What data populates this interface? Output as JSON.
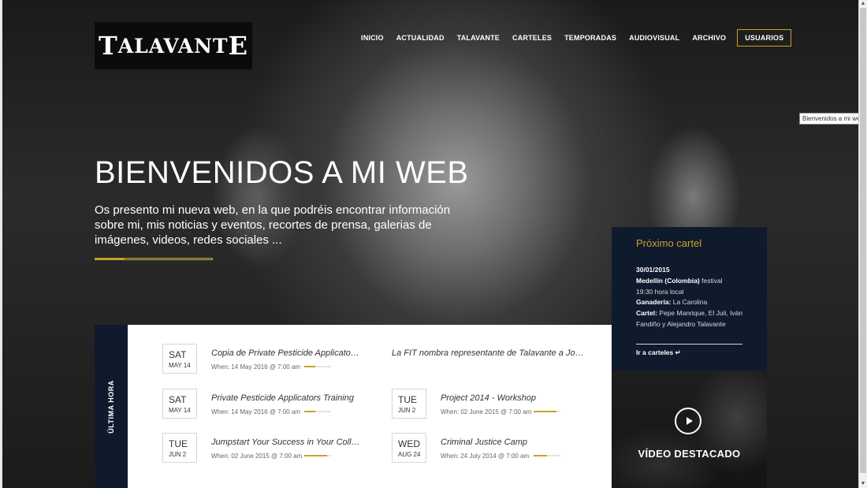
{
  "header": {
    "logo_first": "T",
    "logo_middle": "ALAVANT",
    "logo_last": "E",
    "nav": [
      {
        "label": "INICIO"
      },
      {
        "label": "ACTUALIDAD"
      },
      {
        "label": "TALAVANTE"
      },
      {
        "label": "CARTELES"
      },
      {
        "label": "TEMPORADAS"
      },
      {
        "label": "AUDIOVISUAL"
      },
      {
        "label": "ARCHIVO"
      }
    ],
    "usuarios_label": "USUARIOS"
  },
  "tooltip": "Bienvenidos a mi web",
  "hero": {
    "title": "BIENVENIDOS A MI WEB",
    "text": "Os presento mi nueva web, en la que podréis encontrar información sobre mi, mis noticias y eventos, recortes de prensa, galerias de imágenes, videos, redes sociales ...",
    "progress": 0.25
  },
  "ultima_hora": {
    "label": "ÚLTIMA HORA",
    "events": [
      {
        "dow": "SAT",
        "md": "MAY 14",
        "title": "Copia de Private Pesticide Applicators Training",
        "when": "When: 14 May 2016 @ 7:00 am",
        "progress": 0.4
      },
      {
        "dow": "",
        "md": "",
        "title": "La FIT nombra representante de Talavante a José Luis",
        "when": "",
        "progress": 0
      },
      {
        "dow": "SAT",
        "md": "MAY 14",
        "title": "Private Pesticide Applicators Training",
        "when": "When: 14 May 2016 @ 7:00 am",
        "progress": 0.4
      },
      {
        "dow": "TUE",
        "md": "JUN 2",
        "title": "Project 2014 - Workshop",
        "when": "When: 02 June 2015 @ 7:00 am",
        "progress": 0.85
      },
      {
        "dow": "TUE",
        "md": "JUN 2",
        "title": "Jumpstart Your Success in Your College Career",
        "when": "When: 02 June 2015 @ 7:00 am",
        "progress": 0.85
      },
      {
        "dow": "WED",
        "md": "AUG 24",
        "title": "Criminal Justice Camp",
        "when": "When: 24 July 2014 @ 7:00 am",
        "progress": 0.5
      }
    ]
  },
  "proximo": {
    "title": "Próximo cartel",
    "date": "30/01/2015",
    "place": "Medellín (Colombia)",
    "type": " festival",
    "time": "19:30 hora local",
    "ganaderia_label": "Ganadería:",
    "ganaderia": " La Carolina",
    "cartel_label": "Cartel:",
    "cartel": " Pepe Manrique, El Juli, Iván Fandiño y Alejandro Talavante",
    "link": "Ir a carteles ↵"
  },
  "video": {
    "label": "VÍDEO DESTACADO"
  }
}
